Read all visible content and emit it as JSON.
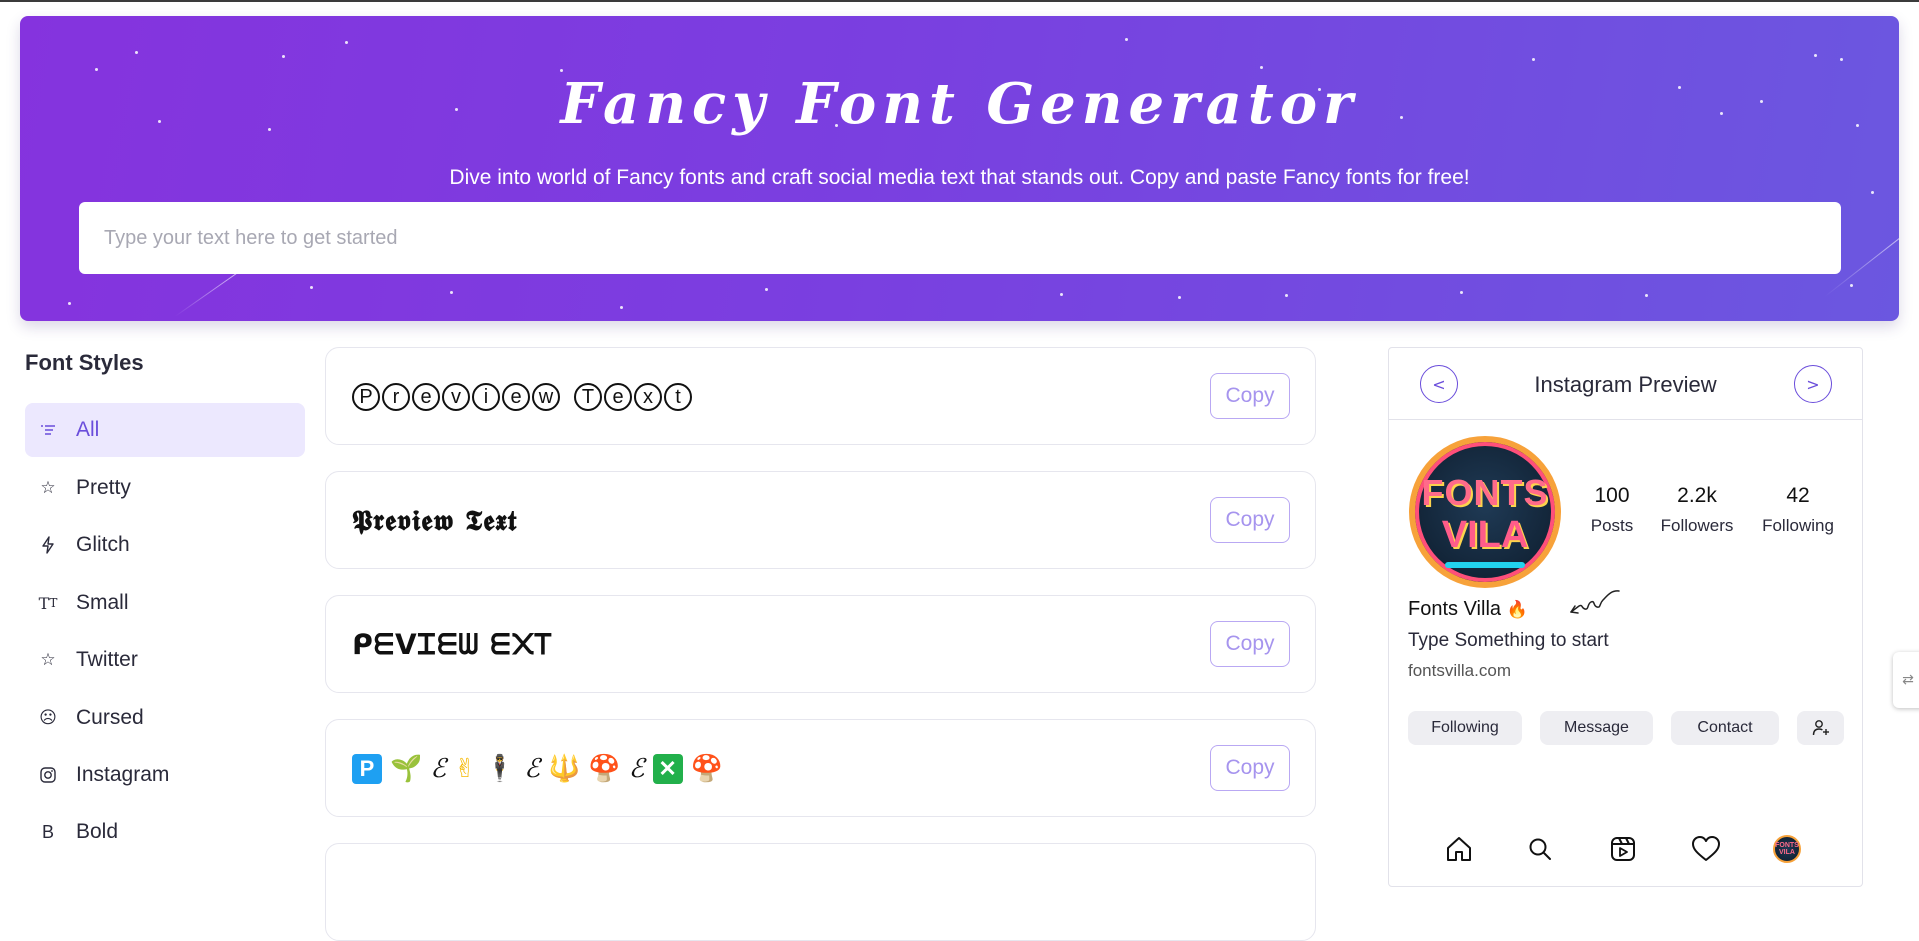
{
  "hero": {
    "title": "Fancy Font Generator",
    "subtitle": "Dive into world of Fancy fonts and craft social media text that stands out. Copy and paste Fancy fonts for free!",
    "input_placeholder": "Type your text here to get started"
  },
  "sidebar": {
    "title": "Font Styles",
    "items": [
      {
        "label": "All",
        "icon": "list-icon",
        "active": true
      },
      {
        "label": "Pretty",
        "icon": "star-icon"
      },
      {
        "label": "Glitch",
        "icon": "bolt-icon"
      },
      {
        "label": "Small",
        "icon": "text-size-icon"
      },
      {
        "label": "Twitter",
        "icon": "star-icon"
      },
      {
        "label": "Cursed",
        "icon": "frown-icon"
      },
      {
        "label": "Instagram",
        "icon": "instagram-icon"
      },
      {
        "label": "Bold",
        "icon": "bold-icon"
      }
    ]
  },
  "results": {
    "copy_label": "Copy",
    "items": [
      {
        "style": "bubble",
        "text": "Ⓟⓡⓔⓥⓘⓔⓦ Ⓣⓔⓧⓣ"
      },
      {
        "style": "blackletter",
        "text": "𝕻𝖗𝖊𝖛𝖎𝖊𝖜 𝕿𝖊𝖝𝖙"
      },
      {
        "style": "glitch",
        "text": "ᑭᗴᐯᏆᗴᗯ ᗴ᙭Ꭲ"
      },
      {
        "style": "emoji",
        "text": "🅿 🌱 ℰ ✌ 🕴 ℰ 🔱 🍄 ℰ ❎ 🍄"
      }
    ]
  },
  "instagram": {
    "title": "Instagram Preview",
    "prev_icon": "chevron-left-icon",
    "next_icon": "chevron-right-icon",
    "avatar_text_line1": "FONTS",
    "avatar_text_line2": "VILA",
    "stats": [
      {
        "value": "100",
        "label": "Posts"
      },
      {
        "value": "2.2k",
        "label": "Followers"
      },
      {
        "value": "42",
        "label": "Following"
      }
    ],
    "name": "Fonts Villa",
    "bio": "Type Something to start",
    "link": "fontsvilla.com",
    "buttons": [
      "Following",
      "Message",
      "Contact"
    ],
    "bottom_nav": [
      "home-icon",
      "search-icon",
      "reels-icon",
      "heart-icon",
      "profile-avatar"
    ]
  },
  "colors": {
    "hero_gradient_start": "#8533de",
    "hero_gradient_end": "#6b57e0",
    "accent": "#6a4ddb",
    "active_bg": "#ece8fe",
    "copy_border": "#b9a8f3"
  }
}
